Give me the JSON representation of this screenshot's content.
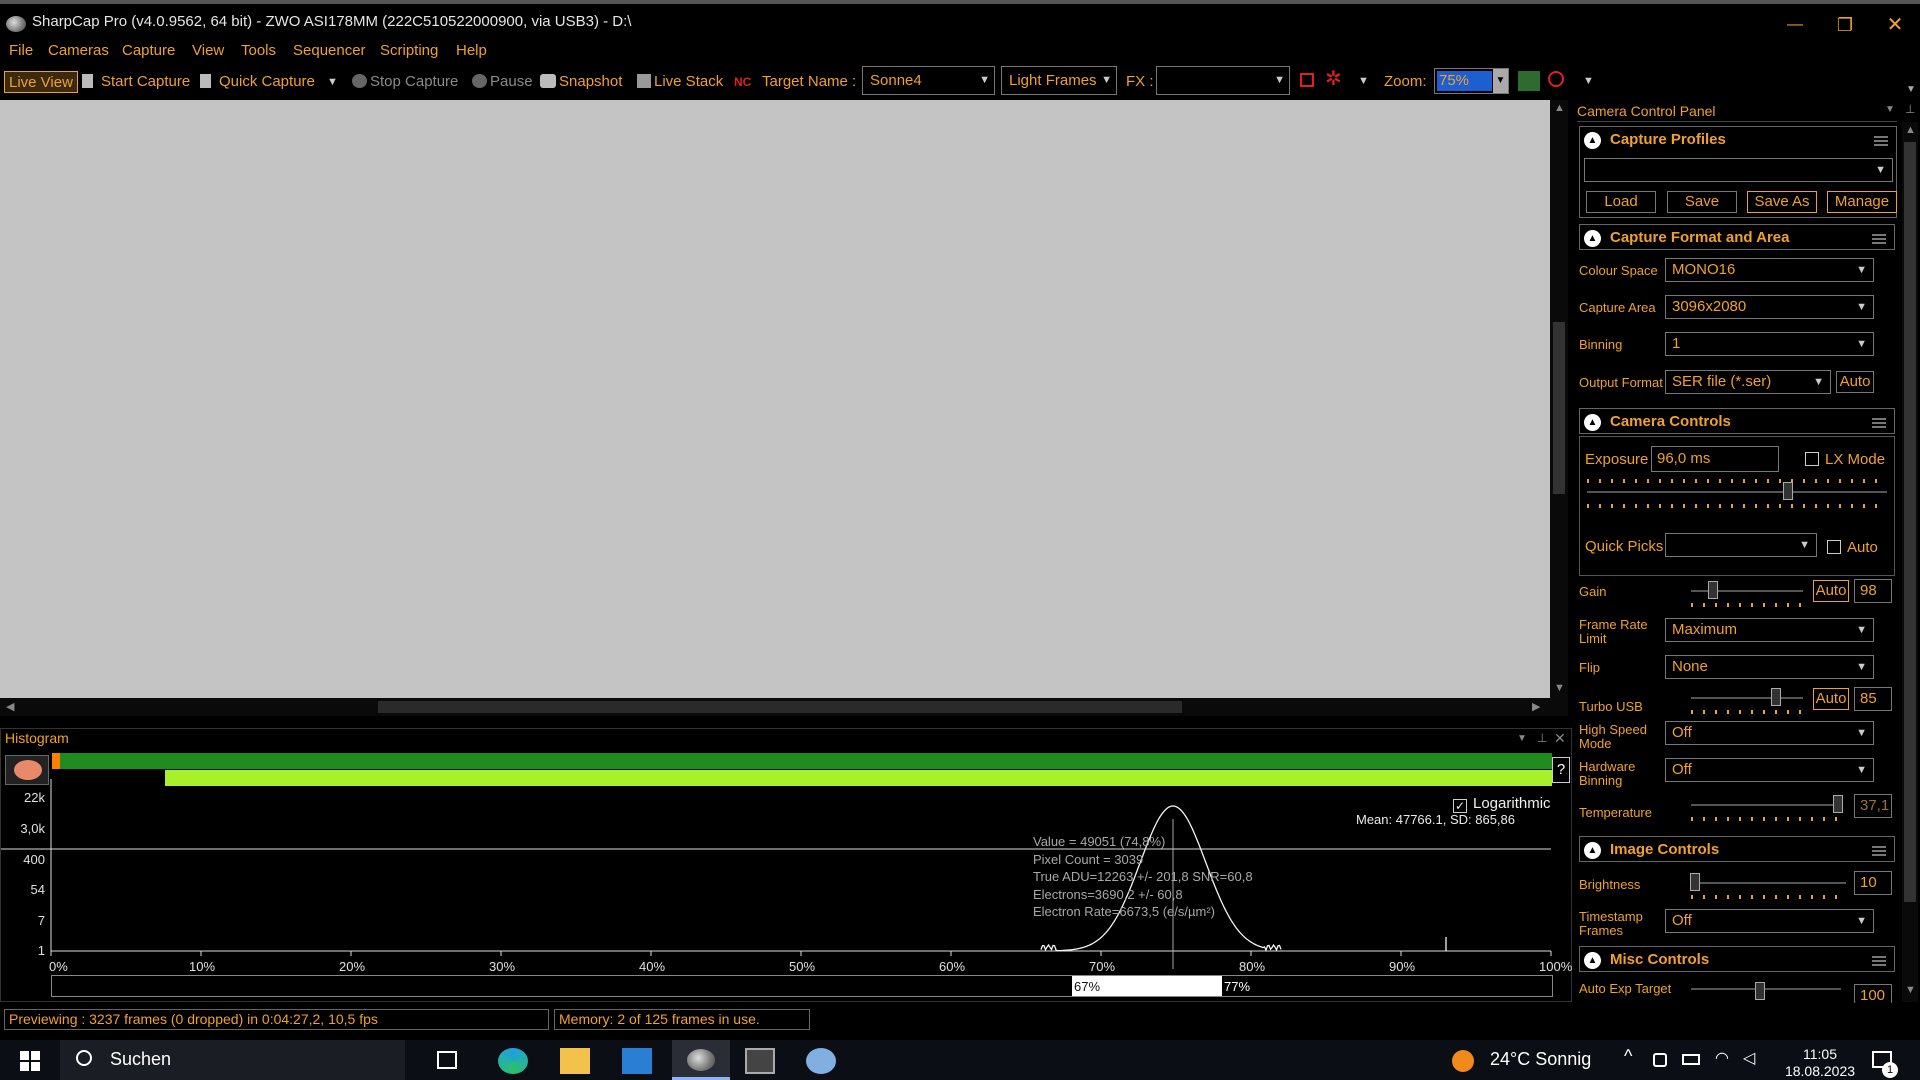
{
  "window": {
    "title": "SharpCap Pro (v4.0.9562, 64 bit) - ZWO ASI178MM (222C510522000900, via USB3) - D:\\",
    "minimize": "—",
    "restore": "❐",
    "close": "✕"
  },
  "menu": [
    "File",
    "Cameras",
    "Capture",
    "View",
    "Tools",
    "Sequencer",
    "Scripting",
    "Help"
  ],
  "toolbar": {
    "live_view": "Live View",
    "start_capture": "Start Capture",
    "quick_capture": "Quick Capture",
    "stop_capture": "Stop Capture",
    "pause": "Pause",
    "snapshot": "Snapshot",
    "live_stack": "Live Stack",
    "target_name_label": "Target Name :",
    "target_name": "Sonne4",
    "frame_type": "Light Frames",
    "fx_label": "FX :",
    "fx_value": "",
    "zoom_label": "Zoom:",
    "zoom_value": "75%"
  },
  "histogram": {
    "title": "Histogram",
    "help": "?",
    "logarithmic_label": "Logarithmic",
    "logarithmic": true,
    "stats": "Mean: 47766.1, SD: 865,86",
    "y_labels": [
      "22k",
      "3,0k",
      "400",
      "54",
      "7",
      "1"
    ],
    "x_labels": [
      "0%",
      "10%",
      "20%",
      "30%",
      "40%",
      "50%",
      "60%",
      "70%",
      "80%",
      "90%",
      "100%"
    ],
    "tooltip": [
      "Value = 49051 (74,8%)",
      "Pixel Count = 3039",
      "True ADU=12263 +/- 201,8 SNR=60,8",
      "Electrons=3690,2 +/- 60,8",
      "Electron Rate=6673,5 (e/s/µm²)"
    ],
    "range_low": "67%",
    "range_high": "77%",
    "curve_peak_percent": 74.8,
    "cursor_percent": 74.8
  },
  "status": {
    "preview": "Previewing : 3237 frames (0 dropped) in 0:04:27,2, 10,5 fps",
    "memory": "Memory: 2 of 125 frames in use."
  },
  "panel": {
    "title": "Camera Control Panel",
    "capture_profiles": {
      "header": "Capture Profiles",
      "profile_value": "",
      "load": "Load",
      "save": "Save",
      "save_as": "Save As",
      "manage": "Manage"
    },
    "capture_format": {
      "header": "Capture Format and Area",
      "colour_space_label": "Colour Space",
      "colour_space": "MONO16",
      "capture_area_label": "Capture Area",
      "capture_area": "3096x2080",
      "binning_label": "Binning",
      "binning": "1",
      "output_format_label": "Output Format",
      "output_format": "SER file (*.ser)",
      "auto": "Auto"
    },
    "camera_controls": {
      "header": "Camera Controls",
      "exposure_label": "Exposure",
      "exposure": "96,0 ms",
      "lx_mode": "LX Mode",
      "quick_picks_label": "Quick Picks",
      "quick_picks": "",
      "auto_label": "Auto",
      "gain_label": "Gain",
      "gain_auto": "Auto",
      "gain": "98",
      "frame_rate_label": "Frame Rate Limit",
      "frame_rate": "Maximum",
      "flip_label": "Flip",
      "flip": "None",
      "turbo_usb_label": "Turbo USB",
      "turbo_auto": "Auto",
      "turbo_usb": "85",
      "high_speed_label": "High Speed Mode",
      "high_speed": "Off",
      "hw_binning_label": "Hardware Binning",
      "hw_binning": "Off",
      "temperature_label": "Temperature",
      "temperature": "37,1"
    },
    "image_controls": {
      "header": "Image Controls",
      "brightness_label": "Brightness",
      "brightness": "10",
      "timestamp_label": "Timestamp Frames",
      "timestamp": "Off"
    },
    "misc_controls": {
      "header": "Misc Controls",
      "auto_exp_target_label": "Auto Exp Target",
      "auto_exp_target": "100"
    }
  },
  "taskbar": {
    "search": "Suchen",
    "weather": "24°C  Sonnig",
    "time": "11:05",
    "date": "18.08.2023",
    "notifications": "1"
  },
  "colors": {
    "accent": "#f0a030",
    "histogram_green": "#1e8c1e",
    "histogram_lime": "#a8f02a",
    "viewport_gray": "#c4c4c4"
  }
}
